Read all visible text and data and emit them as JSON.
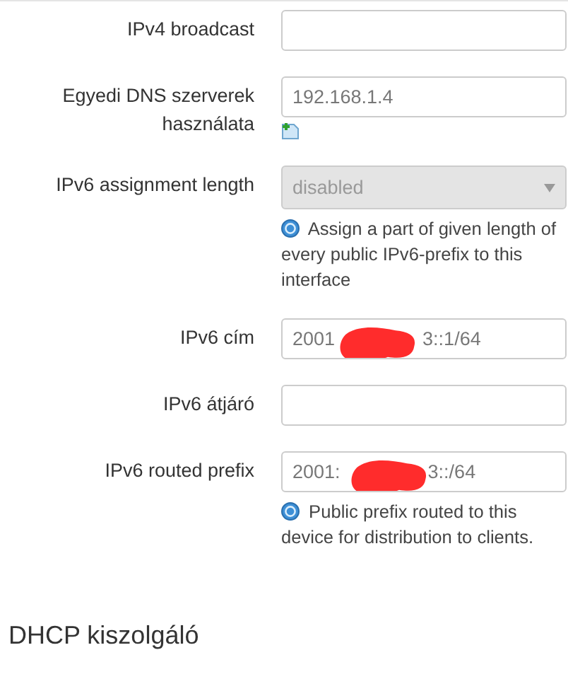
{
  "fields": [
    {
      "kind": "text",
      "label": "IPv4 broadcast"
    },
    {
      "kind": "text",
      "label": "Egyedi DNS szerverek használata",
      "value_parts": [
        "192.168.1.4"
      ],
      "add_button": true
    },
    {
      "kind": "select",
      "label": "IPv6 assignment length",
      "value_parts": [
        "disabled"
      ],
      "disabled": true,
      "help": "Assign a part of given length of every public IPv6-prefix to this interface"
    },
    {
      "kind": "text",
      "label": "IPv6 cím",
      "value_parts": [
        "2001",
        "3::1/64"
      ],
      "redacted": true
    },
    {
      "kind": "text",
      "label": "IPv6 átjáró"
    },
    {
      "kind": "text",
      "label": "IPv6 routed prefix",
      "value_parts": [
        "2001:",
        "3::/64"
      ],
      "redacted": true,
      "help": "Public prefix routed to this device for distribution to clients."
    }
  ],
  "section_heading": "DHCP kiszolgáló"
}
